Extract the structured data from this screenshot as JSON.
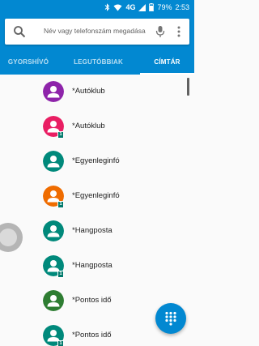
{
  "status_bar": {
    "network_type": "4G",
    "battery_percent": "79%",
    "time": "2:53",
    "icons": [
      "bluetooth-icon",
      "wifi-icon",
      "signal-icon",
      "battery-icon"
    ]
  },
  "search": {
    "placeholder": "Név vagy telefonszám megadása",
    "icons": [
      "search-icon",
      "mic-icon",
      "more-vertical-icon"
    ]
  },
  "tabs": [
    {
      "label": "GYORSHÍVÓ",
      "active": false
    },
    {
      "label": "LEGUTÓBBIAK",
      "active": false
    },
    {
      "label": "CÍMTÁR",
      "active": true
    }
  ],
  "contacts": [
    {
      "name": "*Autóklub",
      "avatar_color": "#8e24aa",
      "sim_badge": ""
    },
    {
      "name": "*Autóklub",
      "avatar_color": "#e91e63",
      "sim_badge": "1"
    },
    {
      "name": "*Egyenleginfó",
      "avatar_color": "#00897b",
      "sim_badge": ""
    },
    {
      "name": "*Egyenleginfó",
      "avatar_color": "#ef6c00",
      "sim_badge": "1"
    },
    {
      "name": "*Hangposta",
      "avatar_color": "#00897b",
      "sim_badge": ""
    },
    {
      "name": "*Hangposta",
      "avatar_color": "#00897b",
      "sim_badge": "1"
    },
    {
      "name": "*Pontos idő",
      "avatar_color": "#2e7d32",
      "sim_badge": ""
    },
    {
      "name": "*Pontos idő",
      "avatar_color": "#00897b",
      "sim_badge": "1"
    }
  ],
  "colors": {
    "primary": "#0288d1",
    "tab_indicator": "#ffffff",
    "sim_badge": "#00796b",
    "background": "#fafafa"
  },
  "fab": {
    "icon": "dialpad-icon"
  }
}
